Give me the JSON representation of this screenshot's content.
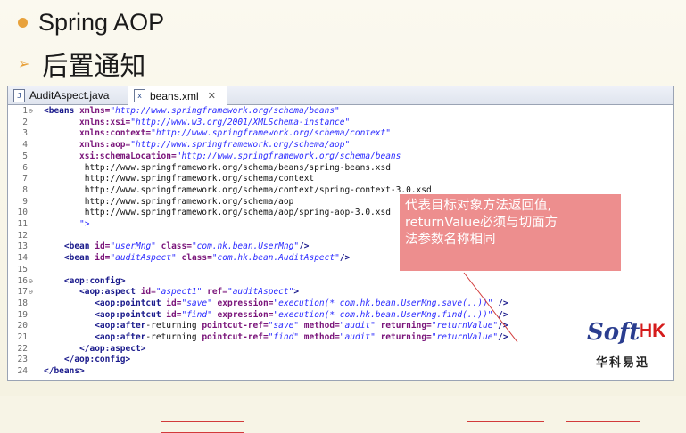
{
  "slide": {
    "bullet1": "Spring AOP",
    "bullet2": "后置通知"
  },
  "tabs": [
    {
      "label": "AuditAspect.java",
      "icon": "java-file-icon"
    },
    {
      "label": "beans.xml",
      "icon": "xml-file-icon",
      "close": "✕"
    }
  ],
  "code_lines": [
    {
      "n": "1",
      "fold": "⊖",
      "text": "<beans xmlns=\"http://www.springframework.org/schema/beans\""
    },
    {
      "n": "2",
      "text": "       xmlns:xsi=\"http://www.w3.org/2001/XMLSchema-instance\""
    },
    {
      "n": "3",
      "text": "       xmlns:context=\"http://www.springframework.org/schema/context\""
    },
    {
      "n": "4",
      "text": "       xmlns:aop=\"http://www.springframework.org/schema/aop\""
    },
    {
      "n": "5",
      "text": "       xsi:schemaLocation=\"http://www.springframework.org/schema/beans"
    },
    {
      "n": "6",
      "text": "        http://www.springframework.org/schema/beans/spring-beans.xsd"
    },
    {
      "n": "7",
      "text": "        http://www.springframework.org/schema/context"
    },
    {
      "n": "8",
      "text": "        http://www.springframework.org/schema/context/spring-context-3.0.xsd"
    },
    {
      "n": "9",
      "text": "        http://www.springframework.org/schema/aop"
    },
    {
      "n": "10",
      "text": "        http://www.springframework.org/schema/aop/spring-aop-3.0.xsd"
    },
    {
      "n": "11",
      "text": "       \">"
    },
    {
      "n": "12",
      "text": ""
    },
    {
      "n": "13",
      "text": "    <bean id=\"userMng\" class=\"com.hk.bean.UserMng\"/>"
    },
    {
      "n": "14",
      "text": "    <bean id=\"auditAspect\" class=\"com.hk.bean.AuditAspect\"/>"
    },
    {
      "n": "15",
      "text": ""
    },
    {
      "n": "16",
      "fold": "⊖",
      "text": "    <aop:config>"
    },
    {
      "n": "17",
      "fold": "⊖",
      "text": "       <aop:aspect id=\"aspect1\" ref=\"auditAspect\">"
    },
    {
      "n": "18",
      "text": "          <aop:pointcut id=\"save\" expression=\"execution(* com.hk.bean.UserMng.save(..))\" />"
    },
    {
      "n": "19",
      "text": "          <aop:pointcut id=\"find\" expression=\"execution(* com.hk.bean.UserMng.find(..))\" />"
    },
    {
      "n": "20",
      "text": "          <aop:after-returning pointcut-ref=\"save\" method=\"audit\" returning=\"returnValue\"/>"
    },
    {
      "n": "21",
      "text": "          <aop:after-returning pointcut-ref=\"find\" method=\"audit\" returning=\"returnValue\"/>"
    },
    {
      "n": "22",
      "text": "       </aop:aspect>"
    },
    {
      "n": "23",
      "text": "    </aop:config>"
    },
    {
      "n": "24",
      "text": "</beans>"
    }
  ],
  "callout": {
    "lines": [
      "代表目标对象方法返回值,",
      "returnValue必须与切面方",
      "法参数名称相同"
    ]
  },
  "logo": {
    "soft": "Soft",
    "hk": "HK",
    "cn": "华科易迅"
  },
  "colors": {
    "accent": "#e8a23c",
    "callout": "#e86e6e",
    "underline": "#d23a3a"
  }
}
